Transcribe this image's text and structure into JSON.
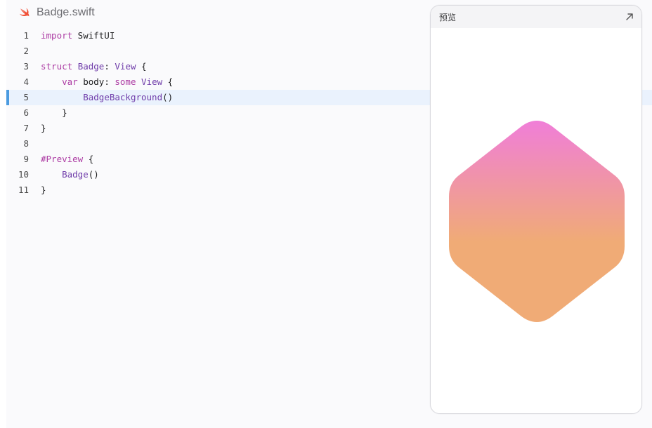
{
  "file": {
    "name": "Badge.swift",
    "icon": "swift-icon"
  },
  "editor": {
    "active_line": 5,
    "lines": [
      {
        "num": "1",
        "tokens": [
          {
            "t": "import",
            "c": "kw"
          },
          {
            "t": " SwiftUI",
            "c": ""
          }
        ]
      },
      {
        "num": "2",
        "tokens": []
      },
      {
        "num": "3",
        "tokens": [
          {
            "t": "struct",
            "c": "kw"
          },
          {
            "t": " ",
            "c": ""
          },
          {
            "t": "Badge",
            "c": "ty"
          },
          {
            "t": ": ",
            "c": ""
          },
          {
            "t": "View",
            "c": "ty"
          },
          {
            "t": " {",
            "c": ""
          }
        ]
      },
      {
        "num": "4",
        "tokens": [
          {
            "t": "    ",
            "c": ""
          },
          {
            "t": "var",
            "c": "kw"
          },
          {
            "t": " body: ",
            "c": ""
          },
          {
            "t": "some",
            "c": "kw"
          },
          {
            "t": " ",
            "c": ""
          },
          {
            "t": "View",
            "c": "ty"
          },
          {
            "t": " {",
            "c": ""
          }
        ]
      },
      {
        "num": "5",
        "tokens": [
          {
            "t": "        ",
            "c": ""
          },
          {
            "t": "BadgeBackground",
            "c": "ty"
          },
          {
            "t": "()",
            "c": ""
          }
        ]
      },
      {
        "num": "6",
        "tokens": [
          {
            "t": "    }",
            "c": ""
          }
        ]
      },
      {
        "num": "7",
        "tokens": [
          {
            "t": "}",
            "c": ""
          }
        ]
      },
      {
        "num": "8",
        "tokens": []
      },
      {
        "num": "9",
        "tokens": [
          {
            "t": "#Preview",
            "c": "kw"
          },
          {
            "t": " {",
            "c": ""
          }
        ]
      },
      {
        "num": "10",
        "tokens": [
          {
            "t": "    ",
            "c": ""
          },
          {
            "t": "Badge",
            "c": "ty"
          },
          {
            "t": "()",
            "c": ""
          }
        ]
      },
      {
        "num": "11",
        "tokens": [
          {
            "t": "}",
            "c": ""
          }
        ]
      }
    ]
  },
  "preview": {
    "title": "预览",
    "expand_icon": "arrow-up-right-icon",
    "badge": {
      "gradient_top": "#f07ed8",
      "gradient_bottom": "#f0ab76"
    }
  },
  "colors": {
    "swift_orange": "#f05138",
    "keyword": "#ad3da4",
    "type": "#703daa",
    "active_line_bg": "#eaf2fd",
    "active_line_marker": "#4b9be0"
  }
}
